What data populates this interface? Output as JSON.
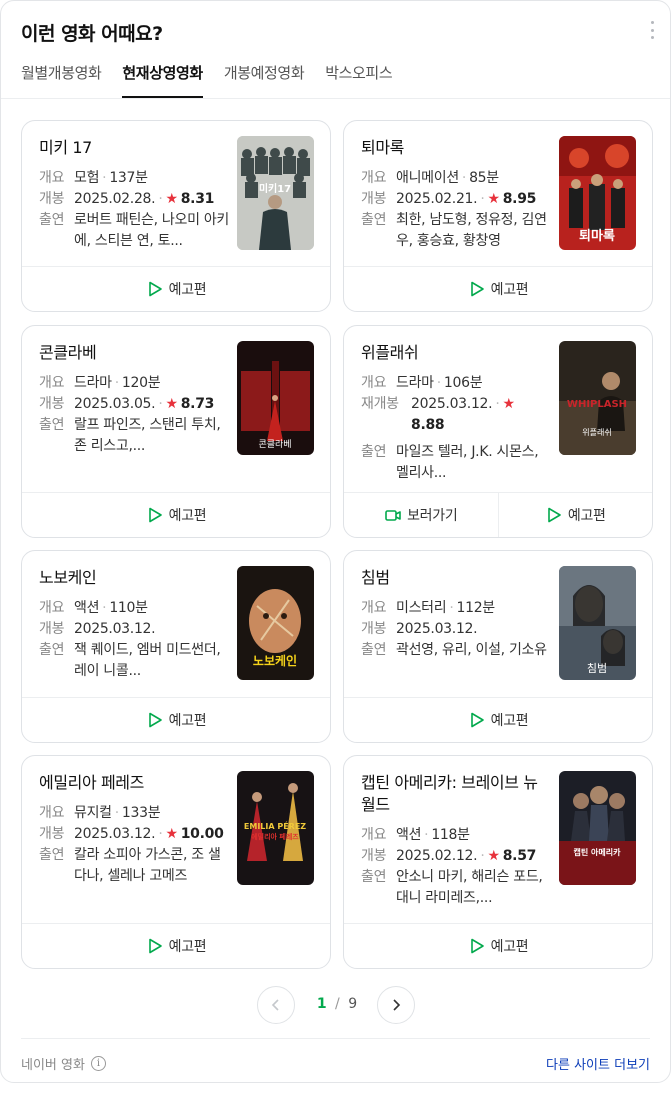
{
  "header": {
    "title": "이런 영화 어때요?"
  },
  "tabs": [
    {
      "label": "월별개봉영화"
    },
    {
      "label": "현재상영영화"
    },
    {
      "label": "개봉예정영화"
    },
    {
      "label": "박스오피스"
    }
  ],
  "labels": {
    "genre": "개요",
    "release": "개봉",
    "rerelease": "재개봉",
    "cast": "출연",
    "trailer": "예고편",
    "watch": "보러가기"
  },
  "movies": [
    {
      "title": "미키 17",
      "genre": "모험",
      "runtime": "137분",
      "date": "2025.02.28.",
      "rating": "8.31",
      "cast": "로버트 패틴슨, 나오미 아키에, 스티븐 연, 토...",
      "poster_text": "미키17"
    },
    {
      "title": "퇴마록",
      "genre": "애니메이션",
      "runtime": "85분",
      "date": "2025.02.21.",
      "rating": "8.95",
      "cast": "최한, 남도형, 정유정, 김연우, 홍승효, 황창영",
      "poster_text": "퇴마록"
    },
    {
      "title": "콘클라베",
      "genre": "드라마",
      "runtime": "120분",
      "date": "2025.03.05.",
      "rating": "8.73",
      "cast": "랄프 파인즈, 스탠리 투치, 존 리스고,...",
      "poster_text": "콘클라베"
    },
    {
      "title": "위플래쉬",
      "genre": "드라마",
      "runtime": "106분",
      "date": "2025.03.12.",
      "rating": "8.88",
      "cast": "마일즈 텔러, J.K. 시몬스, 멜리사...",
      "poster_text": "위플래쉬"
    },
    {
      "title": "노보케인",
      "genre": "액션",
      "runtime": "110분",
      "date": "2025.03.12.",
      "cast": "잭 퀘이드, 엠버 미드썬더, 레이 니콜...",
      "poster_text": "노보케인"
    },
    {
      "title": "침범",
      "genre": "미스터리",
      "runtime": "112분",
      "date": "2025.03.12.",
      "cast": "곽선영, 유리, 이설, 기소유",
      "poster_text": "침범"
    },
    {
      "title": "에밀리아 페레즈",
      "genre": "뮤지컬",
      "runtime": "133분",
      "date": "2025.03.12.",
      "rating": "10.00",
      "cast": "칼라 소피아 가스콘, 조 샐다나, 셀레나 고메즈",
      "poster_text": "EMILIA PÉREZ"
    },
    {
      "title": "캡틴 아메리카: 브레이브 뉴 월드",
      "genre": "액션",
      "runtime": "118분",
      "date": "2025.02.12.",
      "rating": "8.57",
      "cast": "안소니 마키, 해리슨 포드, 대니 라미레즈,...",
      "poster_text": "캡틴 아메리카"
    }
  ],
  "pagination": {
    "current": "1",
    "separator": "/",
    "total": "9"
  },
  "footer": {
    "source": "네이버 영화",
    "info_icon": "i",
    "more_link": "다른 사이트 더보기"
  },
  "colors": {
    "accent_green": "#03a94d",
    "star_red": "#e7323c",
    "link_blue": "#0c3db8"
  }
}
